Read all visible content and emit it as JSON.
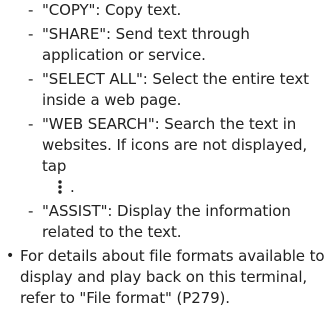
{
  "sub_items": [
    "\"COPY\": Copy text.",
    "\"SHARE\": Send text through application or service.",
    "\"SELECT ALL\": Select the entire text inside a web page.",
    "\"WEB SEARCH\": Search the text in websites. If icons are not displayed, tap",
    "\"ASSIST\": Display the information related to the text."
  ],
  "sub_marker": "-",
  "icon_suffix": ".",
  "icon_name": "more-vert-icon",
  "bullet_marker": "•",
  "bullet_text": "For details about file formats available to display and play back on this terminal, refer to \"File format\" (P279)."
}
